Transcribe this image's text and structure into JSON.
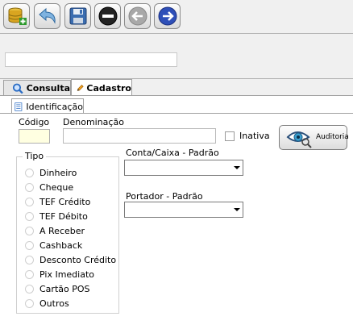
{
  "toolbar": {
    "buttons": [
      {
        "name": "new-record-button",
        "icon": "database-add-icon"
      },
      {
        "name": "undo-button",
        "icon": "undo-arrow-icon"
      },
      {
        "name": "save-button",
        "icon": "floppy-disk-icon"
      },
      {
        "name": "remove-button",
        "icon": "minus-circle-icon"
      },
      {
        "name": "previous-button",
        "icon": "arrow-left-circle-icon"
      },
      {
        "name": "next-button",
        "icon": "arrow-right-circle-icon"
      }
    ]
  },
  "search": {
    "value": ""
  },
  "tabs": [
    {
      "label": "Consulta",
      "icon": "magnifier-icon",
      "active": false
    },
    {
      "label": "Cadastro",
      "icon": "pencil-icon",
      "active": true
    }
  ],
  "subtab": {
    "label": "Identificação",
    "icon": "document-icon"
  },
  "form": {
    "codigo_label": "Código",
    "codigo_value": "",
    "denominacao_label": "Denominação",
    "denominacao_value": "",
    "inativa_label": "Inativa",
    "auditoria_label": "Auditoria",
    "conta_label": "Conta/Caixa - Padrão",
    "conta_value": "",
    "portador_label": "Portador - Padrão",
    "portador_value": ""
  },
  "tipo": {
    "title": "Tipo",
    "options": [
      "Dinheiro",
      "Cheque",
      "TEF Crédito",
      "TEF Débito",
      "A Receber",
      "Cashback",
      "Desconto Crédito",
      "Pix Imediato",
      "Cartão POS",
      "Outros"
    ]
  },
  "colors": {
    "accent_blue": "#2e4fb8",
    "code_field_bg": "#ffffe1",
    "panel_bg": "#ffffff",
    "frame_bg": "#f0f0f0"
  }
}
